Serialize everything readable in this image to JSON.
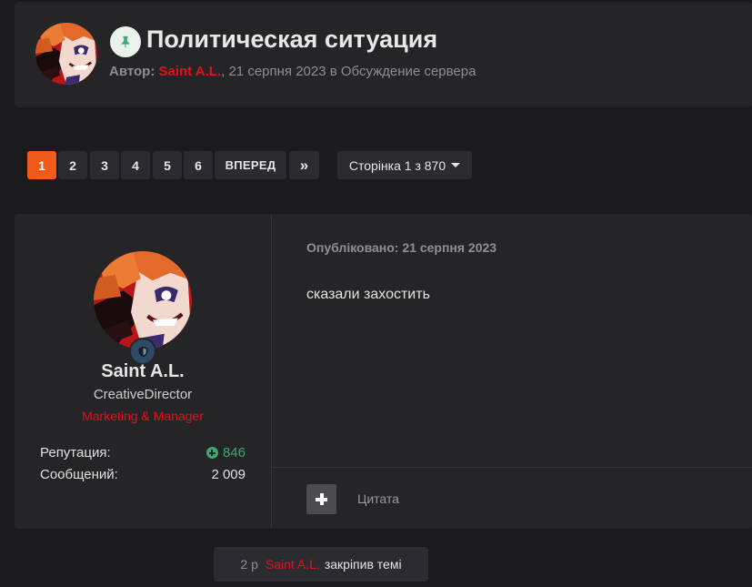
{
  "topic": {
    "title": "Политическая ситуация",
    "pinned_icon": "pin-icon",
    "byline": {
      "prefix": "Автор:",
      "author": "Saint A.L.",
      "separator": ",",
      "date": "21 серпня 2023",
      "in_word": "в",
      "forum": "Обсуждение сервера"
    }
  },
  "pagination": {
    "pages": [
      "1",
      "2",
      "3",
      "4",
      "5",
      "6"
    ],
    "active_page": "1",
    "next_label": "ВПЕРЕД",
    "last_icon": "double-chevron-right-icon",
    "last_glyph": "»",
    "page_jump_label": "Сторінка 1 з 870"
  },
  "post": {
    "author": {
      "name": "Saint A.L.",
      "title": "CreativeDirector",
      "group": "Marketing & Manager",
      "badge_icon": "shield-icon",
      "stats": [
        {
          "label": "Репутация:",
          "value": "846",
          "icon": "plus-circle-icon"
        },
        {
          "label": "Сообщений:",
          "value": "2 009"
        }
      ]
    },
    "published": "Опубліковано: 21 серпня 2023",
    "content": "сказали захостить",
    "multiquote_icon": "plus-icon",
    "quote_label": "Цитата"
  },
  "event": {
    "time": "2 р",
    "user": "Saint A.L.",
    "action": "закріпив темі"
  },
  "colors": {
    "background": "#1b1b1d",
    "card": "#252527",
    "accent_active_page": "#f05a1a",
    "username_red": "#e0121b",
    "reputation_green": "#3ea872"
  }
}
